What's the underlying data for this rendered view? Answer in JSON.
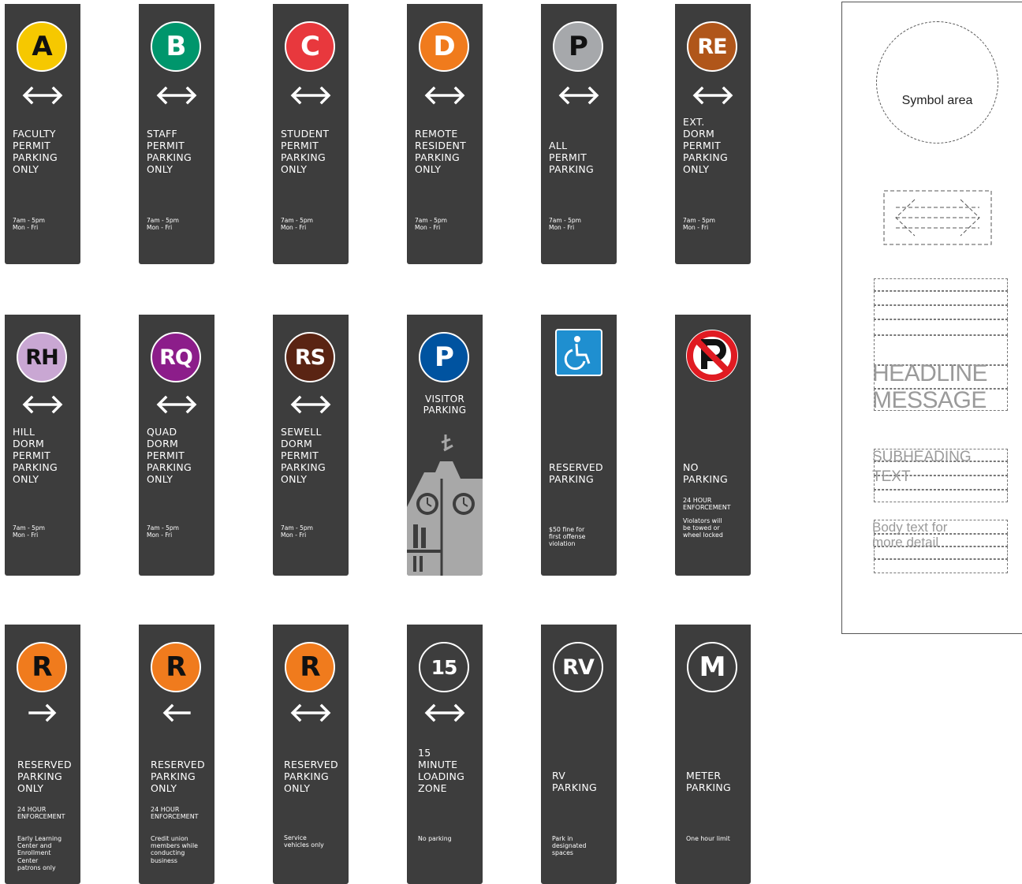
{
  "colors": {
    "sign_bg": "#3d3d3d",
    "A": "#f6c800",
    "B": "#00966c",
    "C": "#e8383d",
    "D": "#f07b1d",
    "P_gray": "#a6a8ab",
    "RE": "#b0561a",
    "RH": "#c9a7d3",
    "RQ": "#8c1d8a",
    "RS": "#5a2413",
    "visitor_blue": "#0053a0",
    "accessible_blue": "#1f8fd0",
    "R": "#f07b1d",
    "no_parking_red": "#e01b22",
    "tower": "#a8a8a8"
  },
  "row1": [
    {
      "symbol": "A",
      "headline": "FACULTY\nPERMIT\nPARKING\nONLY",
      "hours": "7am - 5pm\nMon - Fri"
    },
    {
      "symbol": "B",
      "headline": "STAFF\nPERMIT\nPARKING\nONLY",
      "hours": "7am - 5pm\nMon - Fri"
    },
    {
      "symbol": "C",
      "headline": "STUDENT\nPERMIT\nPARKING\nONLY",
      "hours": "7am - 5pm\nMon - Fri"
    },
    {
      "symbol": "D",
      "headline": "REMOTE\nRESIDENT\nPARKING\nONLY",
      "hours": "7am - 5pm\nMon - Fri"
    },
    {
      "symbol": "P",
      "headline": "ALL\nPERMIT\nPARKING",
      "hours": "7am - 5pm\nMon - Fri"
    },
    {
      "symbol": "RE",
      "headline": "EXT.\nDORM\nPERMIT\nPARKING\nONLY",
      "hours": "7am - 5pm\nMon - Fri"
    }
  ],
  "row2": [
    {
      "symbol": "RH",
      "headline": "HILL\nDORM\nPERMIT\nPARKING\nONLY",
      "hours": "7am - 5pm\nMon - Fri"
    },
    {
      "symbol": "RQ",
      "headline": "QUAD\nDORM\nPERMIT\nPARKING\nONLY",
      "hours": "7am - 5pm\nMon - Fri"
    },
    {
      "symbol": "RS",
      "headline": "SEWELL\nDORM\nPERMIT\nPARKING\nONLY",
      "hours": "7am - 5pm\nMon - Fri"
    },
    {
      "symbol": "P",
      "headline": "VISITOR\nPARKING"
    },
    {
      "symbol": "accessible-icon",
      "headline": "RESERVED\nPARKING",
      "body": "$50 fine for\nfirst offense\nviolation"
    },
    {
      "symbol": "no-parking-icon",
      "headline": "NO\nPARKING",
      "sub": "24 HOUR\nENFORCEMENT",
      "body": "Violators will\nbe towed or\nwheel locked"
    }
  ],
  "row3": [
    {
      "symbol": "R",
      "headline": "RESERVED\nPARKING\nONLY",
      "sub": "24 HOUR\nENFORCEMENT",
      "body": "Early Learning\nCenter and\nEnrollment\nCenter\npatrons only"
    },
    {
      "symbol": "R",
      "headline": "RESERVED\nPARKING\nONLY",
      "sub": "24 HOUR\nENFORCEMENT",
      "body": "Credit union\nmembers while\nconducting\nbusiness"
    },
    {
      "symbol": "R",
      "headline": "RESERVED\nPARKING\nONLY",
      "body": "Service\nvehicles only"
    },
    {
      "symbol": "15",
      "headline": "15\nMINUTE\nLOADING\nZONE",
      "body": "No parking"
    },
    {
      "symbol": "RV",
      "headline": "RV\nPARKING",
      "body": "Park in\ndesignated\nspaces"
    },
    {
      "symbol": "M",
      "headline": "METER\nPARKING",
      "body": "One hour limit"
    }
  ],
  "template": {
    "symbol_area": "Symbol area",
    "headline": "HEADLINE\nMESSAGE",
    "subheading": "SUBHEADING\nTEXT",
    "body": "Body text for\nmore detail"
  }
}
